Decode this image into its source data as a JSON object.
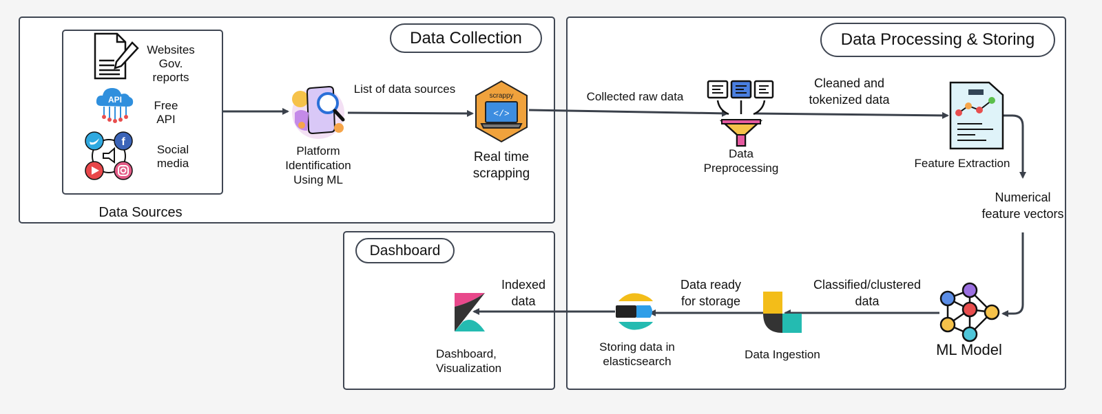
{
  "panels": {
    "data_collection": {
      "title": "Data Collection"
    },
    "data_processing": {
      "title": "Data Processing & Storing"
    },
    "dashboard": {
      "title": "Dashboard"
    }
  },
  "data_sources": {
    "caption": "Data Sources",
    "items": [
      {
        "icon": "document-pen-icon",
        "line1": "Websites",
        "line2": "Gov.",
        "line3": "reports"
      },
      {
        "icon": "api-cloud-icon",
        "line1": "Free",
        "line2": "API"
      },
      {
        "icon": "social-media-icon",
        "line1": "Social",
        "line2": "media"
      }
    ],
    "api_badge": "API"
  },
  "nodes": {
    "platform_identification": {
      "icon": "phone-search-icon",
      "line1": "Platform",
      "line2": "Identification",
      "line3": "Using ML"
    },
    "real_time_scrapping": {
      "icon": "scrappy-laptop-icon",
      "badge": "scrappy",
      "code": "</>",
      "line1": "Real time",
      "line2": "scrapping"
    },
    "data_preprocessing": {
      "icon": "funnel-icon",
      "line1": "Data",
      "line2": "Preprocessing"
    },
    "feature_extraction": {
      "icon": "report-chart-icon",
      "label": "Feature Extraction"
    },
    "ml_model": {
      "icon": "neural-network-icon",
      "label": "ML Model"
    },
    "data_ingestion": {
      "icon": "ingestion-logo-icon",
      "label": "Data Ingestion"
    },
    "elasticsearch": {
      "icon": "elasticsearch-logo-icon",
      "line1": "Storing data in",
      "line2": "elasticsearch"
    },
    "dashboard_viz": {
      "icon": "kibana-logo-icon",
      "line1": "Dashboard,",
      "line2": "Visualization"
    }
  },
  "edges": {
    "list_of_sources": "List of data sources",
    "collected_raw": "Collected raw data",
    "cleaned": {
      "line1": "Cleaned and",
      "line2": "tokenized data"
    },
    "numerical": {
      "line1": "Numerical",
      "line2": "feature vectors"
    },
    "classified": {
      "line1": "Classified/clustered",
      "line2": "data"
    },
    "ready_storage": {
      "line1": "Data ready",
      "line2": "for storage"
    },
    "indexed": {
      "line1": "Indexed",
      "line2": "data"
    }
  },
  "colors": {
    "arrow": "#3a404a",
    "elastic_yellow": "#f3bd19",
    "elastic_teal": "#24bbb1",
    "kibana_pink": "#e8488b",
    "scrappy_orange": "#f0a23c"
  }
}
